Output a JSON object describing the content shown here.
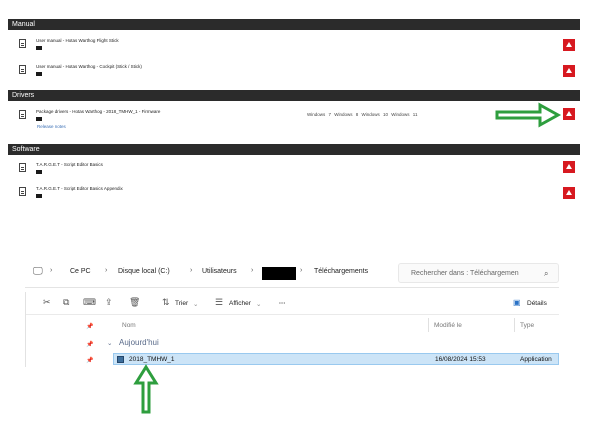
{
  "download_page": {
    "sections": [
      {
        "header": "Manual",
        "rows": [
          {
            "title": "User manual - Hotas Warthog Flight Stick"
          },
          {
            "title": "User manual - Hotas Warthog - Cockpit (Stick / Stick)"
          }
        ]
      },
      {
        "header": "Drivers",
        "rows": [
          {
            "title": "Package drivers - Hotas Warthog - 2018_TMHW_1 - Firmware",
            "link": "Release notes",
            "os": "Windows 7   Windows 8   Windows 10   Windows 11"
          }
        ]
      },
      {
        "header": "Software",
        "rows": [
          {
            "title": "T.A.R.G.E.T - Script Editor Basics"
          },
          {
            "title": "T.A.R.G.E.T - Script Editor Basics Appendix"
          }
        ]
      }
    ],
    "colors": {
      "header_bg": "#2b2b2b",
      "download_button": "#d71920",
      "arrow": "#2e9e3e"
    }
  },
  "explorer": {
    "breadcrumb": {
      "pc": "Ce PC",
      "drive": "Disque local (C:)",
      "users": "Utilisateurs",
      "downloads": "Téléchargements"
    },
    "search": {
      "placeholder": "Rechercher dans : Téléchargemen"
    },
    "toolbar": {
      "sort": "Trier",
      "view": "Afficher",
      "more": "···",
      "details": "Détails"
    },
    "columns": {
      "name": "Nom",
      "modified": "Modifié le",
      "type": "Type"
    },
    "group": "Aujourd'hui",
    "files": [
      {
        "name": "2018_TMHW_1",
        "modified": "16/08/2024 15:53",
        "type": "Application"
      }
    ]
  }
}
